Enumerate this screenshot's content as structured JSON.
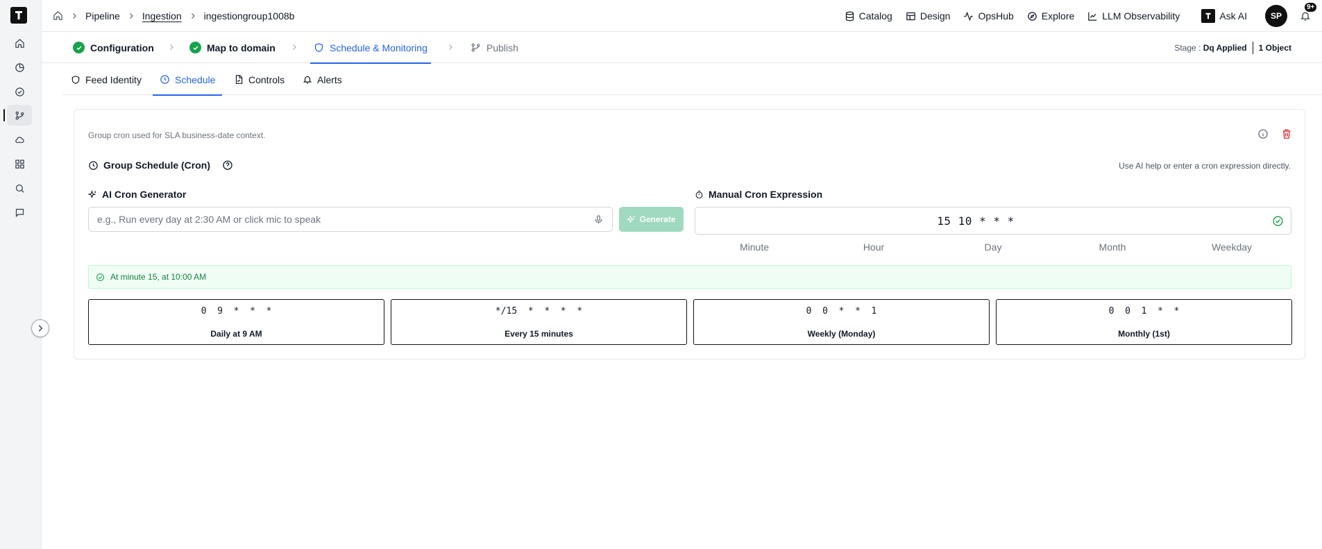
{
  "header": {
    "breadcrumbs": [
      "Pipeline",
      "Ingestion",
      "ingestiongroup1008b"
    ],
    "nav": [
      "Catalog",
      "Design",
      "OpsHub",
      "Explore",
      "LLM Observability",
      "Ask AI"
    ],
    "avatar_initials": "SP",
    "notification_badge": "9+"
  },
  "steps": [
    {
      "label": "Configuration",
      "status": "done"
    },
    {
      "label": "Map to domain",
      "status": "done"
    },
    {
      "label": "Schedule & Monitoring",
      "status": "active"
    },
    {
      "label": "Publish",
      "status": "pending"
    }
  ],
  "stage": {
    "prefix": "Stage : ",
    "value": "Dq Applied",
    "objects": "1 Object"
  },
  "subtabs": [
    "Feed Identity",
    "Schedule",
    "Controls",
    "Alerts"
  ],
  "active_subtab": "Schedule",
  "card": {
    "description": "Group cron used for SLA business-date context.",
    "title": "Group Schedule (Cron)",
    "hint": "Use AI help or enter a cron expression directly.",
    "ai": {
      "label": "AI Cron Generator",
      "placeholder": "e.g., Run every day at 2:30 AM or click mic to speak",
      "value": "",
      "button": "Generate"
    },
    "manual": {
      "label": "Manual Cron Expression",
      "value": "15 10 * * *",
      "fields": [
        "Minute",
        "Hour",
        "Day",
        "Month",
        "Weekday"
      ]
    },
    "result": "At minute 15, at 10:00 AM",
    "presets": [
      {
        "expr": "0 9 * * *",
        "label": "Daily at 9 AM"
      },
      {
        "expr": "*/15 * * * *",
        "label": "Every 15 minutes"
      },
      {
        "expr": "0 0 * * 1",
        "label": "Weekly (Monday)"
      },
      {
        "expr": "0 0 1 * *",
        "label": "Monthly (1st)"
      }
    ]
  },
  "colors": {
    "accent": "#2563eb",
    "success": "#16a34a",
    "danger": "#dc2626",
    "generate_disabled": "#9fd9bf"
  }
}
